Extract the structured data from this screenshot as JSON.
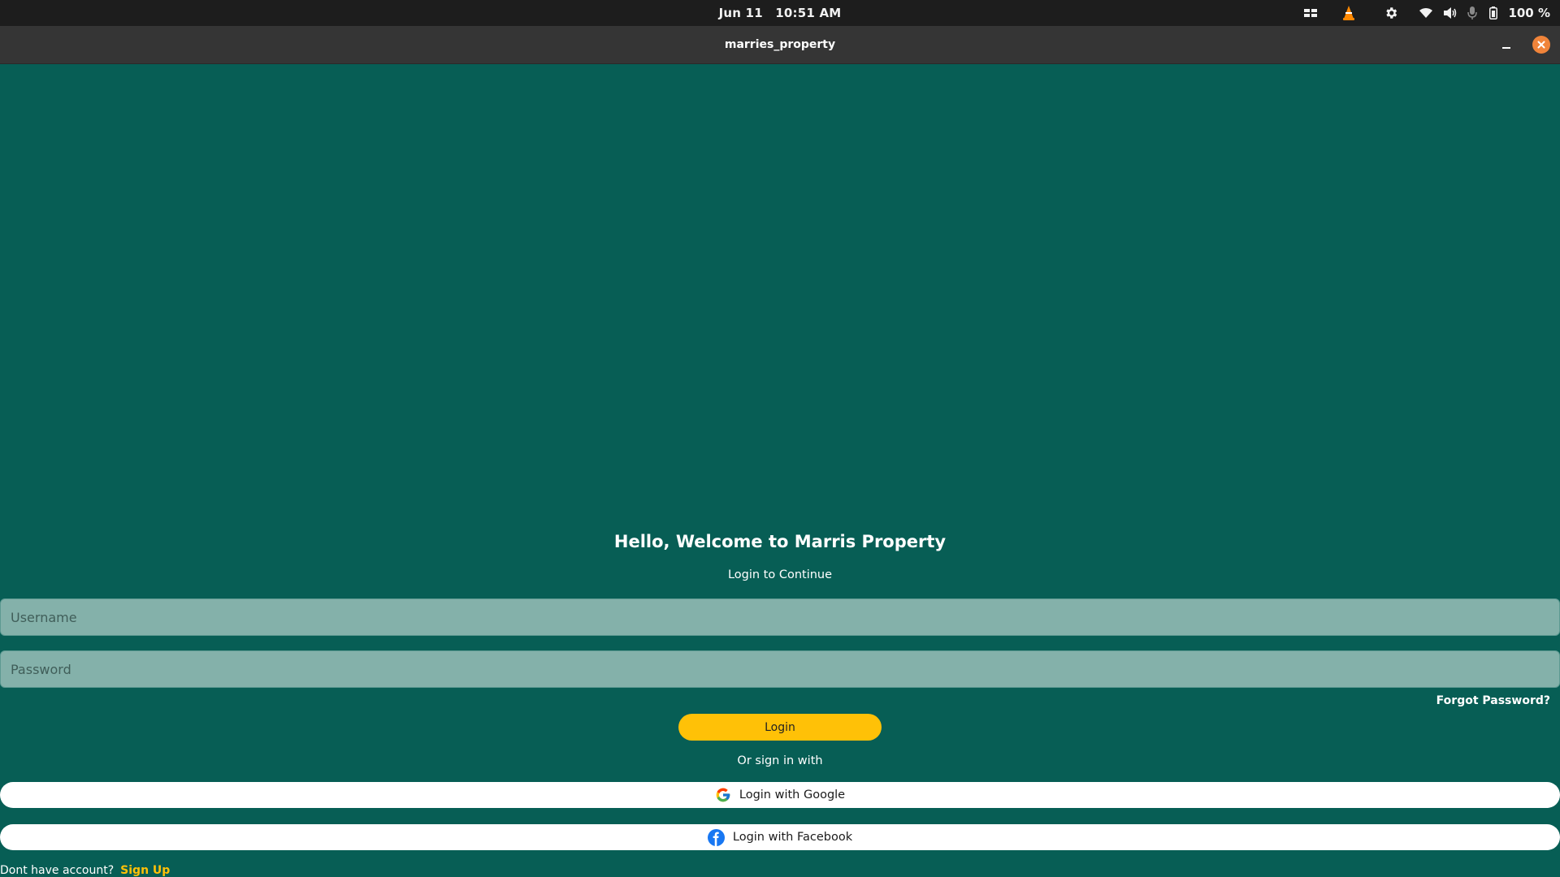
{
  "system_bar": {
    "date": "Jun 11",
    "time": "10:51 AM",
    "battery": "100 %",
    "tray_icons": [
      "window-switcher-icon",
      "vlc-icon",
      "settings-gear-icon",
      "wifi-icon",
      "volume-icon",
      "microphone-icon",
      "battery-icon"
    ]
  },
  "window": {
    "title": "marries_property"
  },
  "login": {
    "welcome": "Hello, Welcome to Marris Property",
    "subtitle": "Login to Continue",
    "username_placeholder": "Username",
    "password_placeholder": "Password",
    "forgot_password": "Forgot Password?",
    "login_button": "Login",
    "or_sign_in": "Or sign in with",
    "google_button": "Login with Google",
    "facebook_button": "Login with Facebook",
    "no_account": "Dont have account?",
    "sign_up": "Sign Up"
  },
  "colors": {
    "background": "#075e55",
    "field": "#84b1aa",
    "accent": "#ffc107",
    "close_button": "#f0843a",
    "facebook_blue": "#1877f2"
  }
}
